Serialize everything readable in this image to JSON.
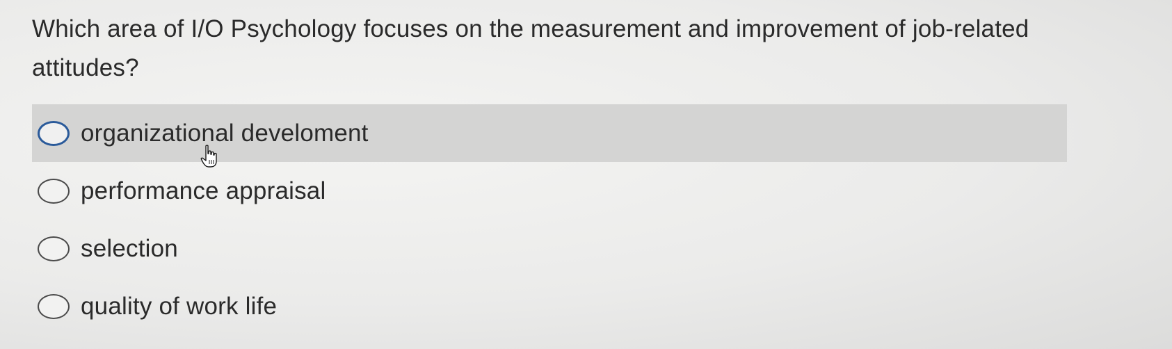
{
  "question": {
    "text": "Which area of I/O Psychology focuses on the measurement and improvement of job-related attitudes?"
  },
  "options": [
    {
      "label": "organizational develoment",
      "selected": false,
      "hovered": true
    },
    {
      "label": "performance appraisal",
      "selected": false,
      "hovered": false
    },
    {
      "label": "selection",
      "selected": false,
      "hovered": false
    },
    {
      "label": "quality of work life",
      "selected": false,
      "hovered": false
    }
  ],
  "colors": {
    "hover_highlight": "#d4d4d3",
    "radio_focus_border": "#2a5a9a",
    "text": "#2a2a2a"
  },
  "cursor": {
    "icon": "hand-pointer-icon"
  }
}
